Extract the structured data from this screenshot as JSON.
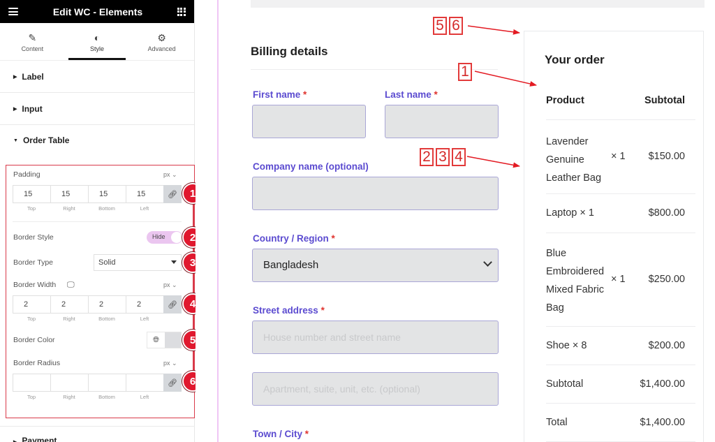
{
  "panel": {
    "title": "Edit WC - Elements",
    "menu_icon": "hamburger-icon",
    "apps_icon": "grid-icon",
    "tabs": [
      {
        "label": "Content",
        "icon": "pencil-icon"
      },
      {
        "label": "Style",
        "icon": "contrast-icon",
        "active": true
      },
      {
        "label": "Advanced",
        "icon": "gear-icon"
      }
    ],
    "sections": [
      {
        "label": "Label",
        "open": false
      },
      {
        "label": "Input",
        "open": false
      },
      {
        "label": "Order Table",
        "open": true
      },
      {
        "label": "Payment",
        "open": false
      }
    ],
    "order_table": {
      "padding": {
        "label": "Padding",
        "unit": "px",
        "top": "15",
        "right": "15",
        "bottom": "15",
        "left": "15"
      },
      "border_style": {
        "label": "Border Style",
        "toggle_text": "Hide"
      },
      "border_type": {
        "label": "Border Type",
        "value": "Solid"
      },
      "border_width": {
        "label": "Border Width",
        "unit": "px",
        "top": "2",
        "right": "2",
        "bottom": "2",
        "left": "2"
      },
      "border_color": {
        "label": "Border Color",
        "swatch": "#dcdde0"
      },
      "border_radius": {
        "label": "Border Radius",
        "unit": "px",
        "top": "",
        "right": "",
        "bottom": "",
        "left": ""
      },
      "dim_labels": {
        "top": "Top",
        "right": "Right",
        "bottom": "Bottom",
        "left": "Left"
      }
    },
    "badges": [
      "1",
      "2",
      "3",
      "4",
      "5",
      "6"
    ]
  },
  "billing": {
    "title": "Billing details",
    "required_mark": "*",
    "fields": {
      "first_name": {
        "label": "First name"
      },
      "last_name": {
        "label": "Last name"
      },
      "company": {
        "label": "Company name (optional)"
      },
      "country": {
        "label": "Country / Region",
        "value": "Bangladesh"
      },
      "street": {
        "label": "Street address",
        "placeholder1": "House number and street name",
        "placeholder2": "Apartment, suite, unit, etc. (optional)"
      },
      "city": {
        "label": "Town / City"
      }
    }
  },
  "order": {
    "title": "Your order",
    "headers": {
      "product": "Product",
      "subtotal": "Subtotal"
    },
    "items": [
      {
        "name_lines": [
          "Lavender",
          "Genuine",
          "Leather Bag"
        ],
        "qty": "× 1",
        "price": "$150.00"
      },
      {
        "name": "Laptop × 1",
        "price": "$800.00"
      },
      {
        "name_lines": [
          "Blue",
          "Embroidered",
          "Mixed Fabric",
          "Bag"
        ],
        "qty": "× 1",
        "price": "$250.00"
      },
      {
        "name": "Shoe × 8",
        "price": "$200.00"
      }
    ],
    "subtotal": {
      "label": "Subtotal",
      "value": "$1,400.00"
    },
    "total": {
      "label": "Total",
      "value": "$1,400.00"
    }
  },
  "callouts": {
    "a": [
      "5",
      "6"
    ],
    "b": [
      "1"
    ],
    "c": [
      "2",
      "3",
      "4"
    ]
  },
  "colors": {
    "accent_label": "#5b4bd0",
    "required": "#e0342f",
    "annotation_red": "#e0182e",
    "toggle_bg": "#ebc6f0"
  }
}
